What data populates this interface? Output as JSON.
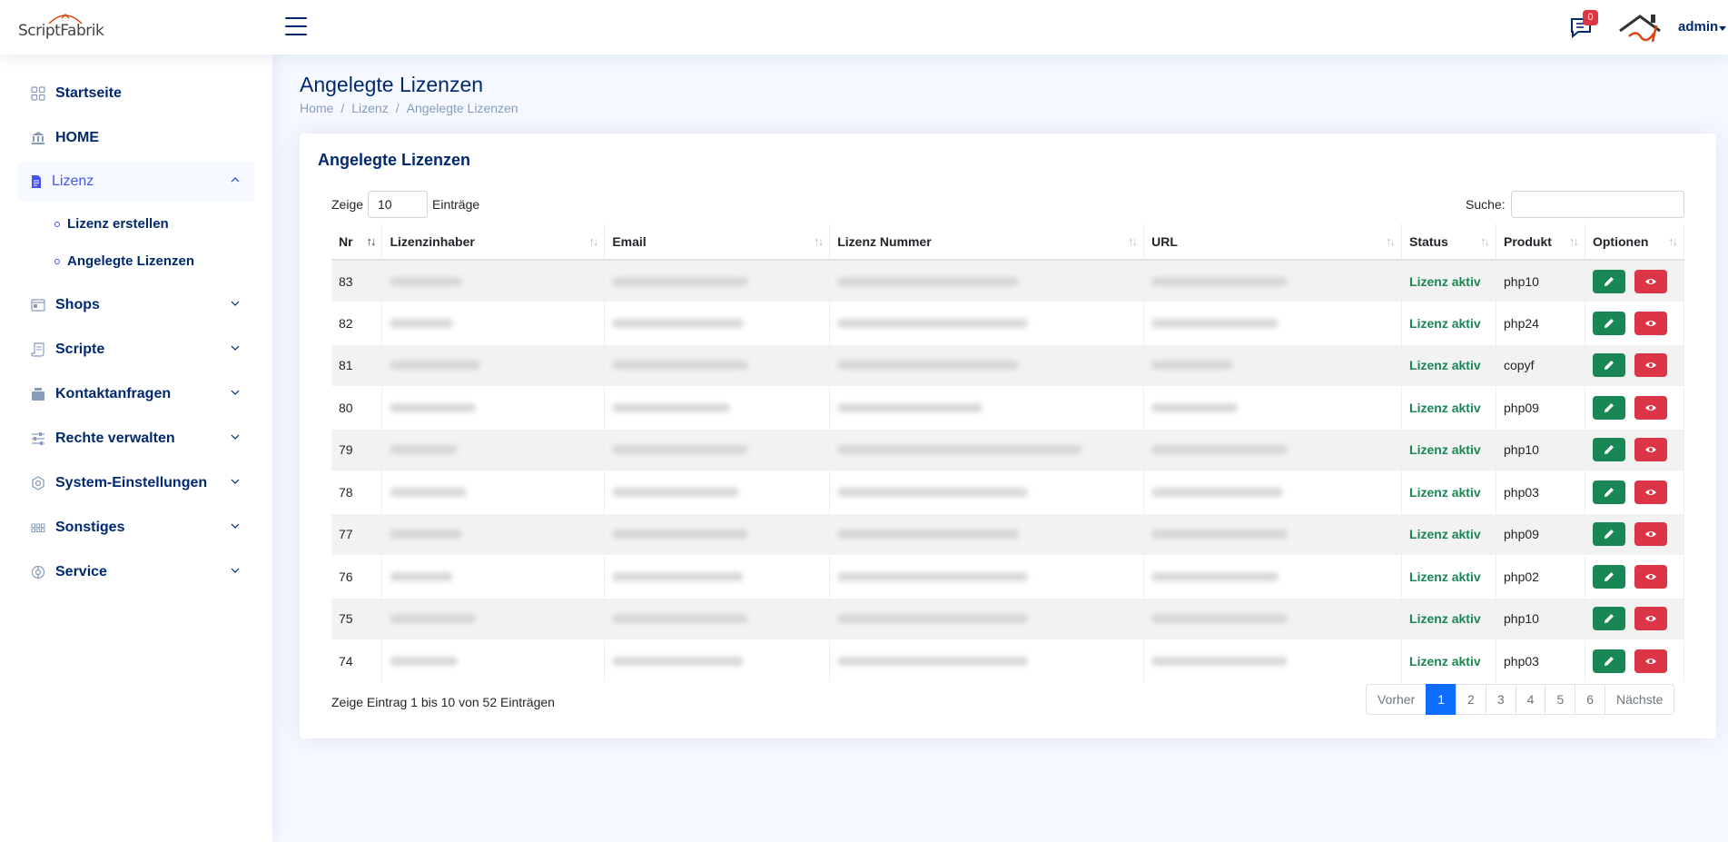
{
  "header": {
    "logo_text": "ScriptFabrik",
    "notification_count": "0",
    "user_name": "admin"
  },
  "sidebar": {
    "items": [
      {
        "label": "Startseite",
        "icon": "grid-icon"
      },
      {
        "label": "HOME",
        "icon": "bank-icon"
      },
      {
        "label": "Lizenz",
        "icon": "document-icon",
        "expanded": true
      },
      {
        "label": "Shops",
        "icon": "window-icon"
      },
      {
        "label": "Scripte",
        "icon": "script-icon"
      },
      {
        "label": "Kontaktanfragen",
        "icon": "inbox-icon"
      },
      {
        "label": "Rechte verwalten",
        "icon": "sliders-icon"
      },
      {
        "label": "System-Einstellungen",
        "icon": "gear-icon"
      },
      {
        "label": "Sonstiges",
        "icon": "apps-icon"
      },
      {
        "label": "Service",
        "icon": "service-icon"
      }
    ],
    "sub_items": [
      {
        "label": "Lizenz erstellen"
      },
      {
        "label": "Angelegte Lizenzen"
      }
    ]
  },
  "page": {
    "title": "Angelegte Lizenzen",
    "breadcrumb": [
      "Home",
      "Lizenz",
      "Angelegte Lizenzen"
    ]
  },
  "card": {
    "title": "Angelegte Lizenzen",
    "length_label_before": "Zeige",
    "length_value": "10",
    "length_label_after": "Einträge",
    "search_label": "Suche:",
    "search_value": ""
  },
  "table": {
    "columns": [
      "Nr",
      "Lizenzinhaber",
      "Email",
      "Lizenz Nummer",
      "URL",
      "Status",
      "Produkt",
      "Optionen"
    ],
    "rows": [
      {
        "nr": "83",
        "status": "Lizenz aktiv",
        "produkt": "php10"
      },
      {
        "nr": "82",
        "status": "Lizenz aktiv",
        "produkt": "php24"
      },
      {
        "nr": "81",
        "status": "Lizenz aktiv",
        "produkt": "copyf"
      },
      {
        "nr": "80",
        "status": "Lizenz aktiv",
        "produkt": "php09"
      },
      {
        "nr": "79",
        "status": "Lizenz aktiv",
        "produkt": "php10"
      },
      {
        "nr": "78",
        "status": "Lizenz aktiv",
        "produkt": "php03"
      },
      {
        "nr": "77",
        "status": "Lizenz aktiv",
        "produkt": "php09"
      },
      {
        "nr": "76",
        "status": "Lizenz aktiv",
        "produkt": "php02"
      },
      {
        "nr": "75",
        "status": "Lizenz aktiv",
        "produkt": "php10"
      },
      {
        "nr": "74",
        "status": "Lizenz aktiv",
        "produkt": "php03"
      }
    ]
  },
  "footer": {
    "info": "Zeige Eintrag 1 bis 10 von 52 Einträgen",
    "pager": [
      "Vorher",
      "1",
      "2",
      "3",
      "4",
      "5",
      "6",
      "Nächste"
    ],
    "active_page": "1"
  },
  "colors": {
    "primary": "#012970",
    "accent": "#4154f1",
    "success": "#198754",
    "danger": "#dc3545",
    "page_active": "#0d6efd"
  }
}
